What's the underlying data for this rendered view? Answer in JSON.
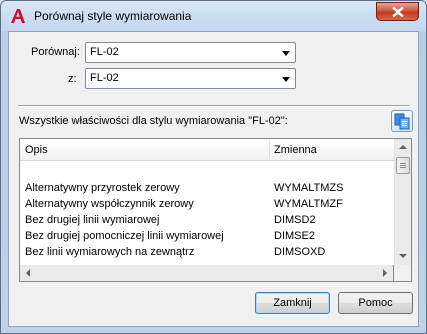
{
  "window": {
    "title": "Porównaj style wymiarowania",
    "app_icon": "autocad-a-icon",
    "close_icon": "close-x-icon"
  },
  "compare": {
    "label": "Porównaj:",
    "value": "FL-02"
  },
  "with": {
    "label": "z:",
    "value": "FL-02"
  },
  "properties_label": "Wszystkie właściwości dla stylu wymiarowania \"FL-02\":",
  "copy_button_icon": "copy-to-clipboard-icon",
  "table": {
    "columns": [
      "Opis",
      "Zmienna"
    ],
    "rows": [
      {
        "opis": "",
        "zmienna": ""
      },
      {
        "opis": "Alternatywny przyrostek zerowy",
        "zmienna": "WYMALTMZS"
      },
      {
        "opis": "Alternatywny współczynnik zerowy",
        "zmienna": "WYMALTMZF"
      },
      {
        "opis": "Bez drugiej linii wymiarowej",
        "zmienna": "DIMSD2"
      },
      {
        "opis": "Bez drugiej pomocniczej linii wymiarowej",
        "zmienna": "DIMSE2"
      },
      {
        "opis": "Bez linii wymiarowych na zewnątrz",
        "zmienna": "DIMSOXD"
      }
    ]
  },
  "buttons": {
    "close": "Zamknij",
    "help": "Pomoc"
  },
  "colors": {
    "title_gradient": "#c2d6ef",
    "close_button": "#c23a1f",
    "client_bg": "#f0f0f0",
    "default_button_border": "#3c7fb1"
  }
}
